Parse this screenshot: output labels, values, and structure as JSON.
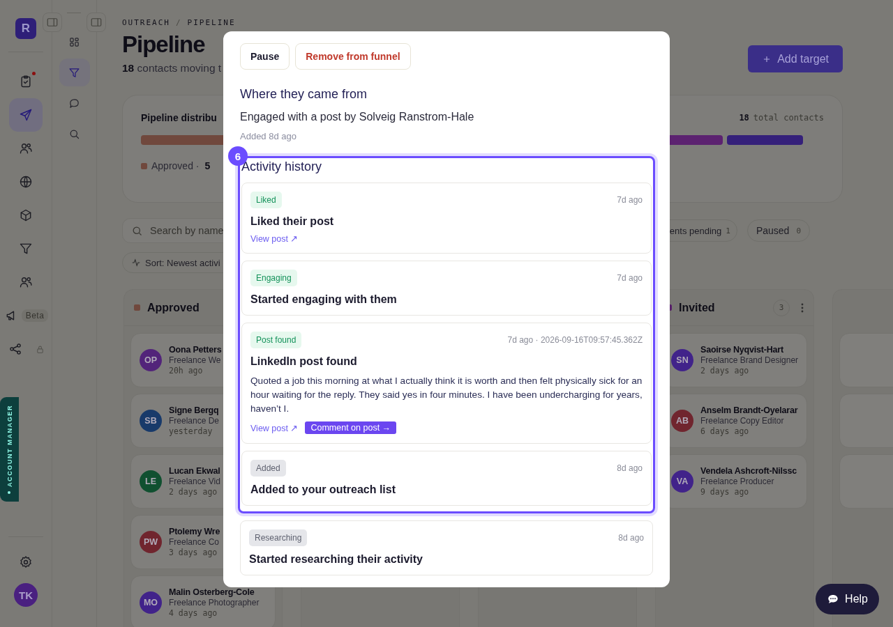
{
  "rail": {
    "logo": "R",
    "items": [
      {
        "selected": false,
        "unread": true
      },
      {
        "selected": true,
        "unread": false
      },
      {
        "selected": false,
        "unread": false
      },
      {
        "selected": false,
        "unread": false
      },
      {
        "selected": false,
        "unread": false
      },
      {
        "selected": false,
        "unread": false
      },
      {
        "selected": false,
        "unread": false
      },
      {
        "selected": false,
        "unread": false,
        "badge": "Beta"
      },
      {
        "selected": false,
        "unread": false,
        "locked": true
      }
    ],
    "account_tab": "ACCOUNT MANAGER",
    "user": "TK"
  },
  "subnav": {
    "items": [
      {
        "selected": false
      },
      {
        "selected": true
      },
      {
        "selected": false
      },
      {
        "selected": false
      }
    ]
  },
  "header": {
    "breadcrumb": [
      "OUTREACH",
      "/",
      "PIPELINE"
    ],
    "title": "Pipeline",
    "subtitle": "**18** contacts moving t",
    "add_button": "Add target"
  },
  "distribution": {
    "title": "Pipeline distribu",
    "total": "18",
    "total_label": "total contacts",
    "legend": [
      {
        "label": "Approved ·",
        "count": "5",
        "color": "#70483d"
      }
    ]
  },
  "filters": {
    "search_placeholder": "Search by name",
    "chips": [
      {
        "label": "ents pending",
        "count": "1"
      },
      {
        "label": "Paused",
        "count": "0"
      }
    ],
    "sort": "Sort: Newest activi"
  },
  "board": [
    {
      "kind": "cards",
      "name": "Approved",
      "color": "#70483d",
      "cards": [
        {
          "initials": "OP",
          "name": "Oona Petters",
          "role": "Freelance We",
          "time": "20h ago",
          "color": "#52247a"
        },
        {
          "initials": "SB",
          "name": "Signe Bergq",
          "role": "Freelance De",
          "time": "yesterday",
          "color": "#183a6a"
        },
        {
          "initials": "LE",
          "name": "Lucan Ekwal",
          "role": "Freelance Vid",
          "time": "2 days ago",
          "color": "#105030"
        },
        {
          "initials": "PW",
          "name": "Ptolemy Wre",
          "role": "Freelance Co",
          "time": "3 days ago",
          "color": "#70252e"
        },
        {
          "initials": "MO",
          "name": "Malin Osterberg-Cole",
          "role": "Freelance Photographer",
          "time": "4 days ago",
          "color": "#41238a"
        }
      ]
    },
    {
      "kind": "empty"
    },
    {
      "kind": "empty"
    },
    {
      "kind": "cards",
      "name": "Invited",
      "count": "3",
      "color": "#58206a",
      "cards": [
        {
          "initials": "SN",
          "name": "Saoirse Nyqvist-Hart",
          "role": "Freelance Brand Designer",
          "time": "2 days ago",
          "color": "#41238a"
        },
        {
          "initials": "AB",
          "name": "Anselm Brandt-Oyelarar",
          "role": "Freelance Copy Editor",
          "time": "6 days ago",
          "color": "#70252e"
        },
        {
          "initials": "VA",
          "name": "Vendela Ashcroft-Nilssc",
          "role": "Freelance Producer",
          "time": "9 days ago",
          "color": "#41238a"
        }
      ]
    },
    {
      "kind": "blank_cards"
    }
  ],
  "modal": {
    "actions": [
      {
        "label": "Pause",
        "kind": "default"
      },
      {
        "label": "Remove from funnel",
        "kind": "danger"
      }
    ],
    "source": {
      "heading": "Where they came from",
      "text": "Engaged with a post by Solveig Ranstrom-Hale",
      "added": "Added 8d ago"
    },
    "activity": {
      "heading": "Activity history",
      "highlight_badge": "6",
      "items": [
        {
          "tag": "Liked",
          "kind": "success",
          "time": "7d ago",
          "title": "Liked their post",
          "links": [
            {
              "label": "View post ↗",
              "kind": "link"
            }
          ]
        },
        {
          "tag": "Engaging",
          "kind": "success",
          "time": "7d ago",
          "title": "Started engaging with them"
        },
        {
          "tag": "Post found",
          "kind": "success",
          "time": "7d ago · 2026-09-16T09:57:45.362Z",
          "title": "LinkedIn post found",
          "body": "Quoted a job this morning at what I actually think it is worth and then felt physically sick for an hour waiting for the reply. They said yes in four minutes. I have been undercharging for years, haven’t I.",
          "links": [
            {
              "label": "View post ↗",
              "kind": "link"
            },
            {
              "label": "Comment on post →",
              "kind": "primary"
            }
          ]
        },
        {
          "tag": "Added",
          "kind": "neutral",
          "time": "8d ago",
          "title": "Added to your outreach list"
        }
      ],
      "after": [
        {
          "tag": "Researching",
          "kind": "neutral",
          "time": "8d ago",
          "title": "Started researching their activity"
        }
      ]
    }
  },
  "help": "Help"
}
